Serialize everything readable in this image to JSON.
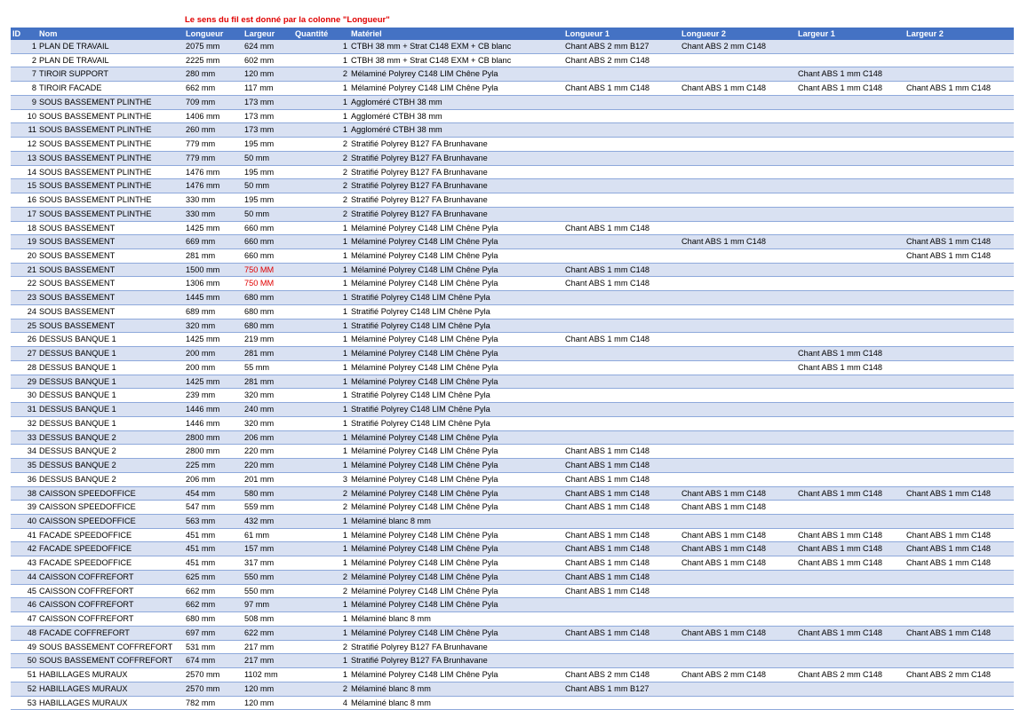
{
  "note": "Le sens du fil est donné par la colonne \"Longueur\"",
  "headers": [
    "ID",
    "Nom",
    "Longueur",
    "Largeur",
    "Quantité",
    "Matériel",
    "Longueur 1",
    "Longueur 2",
    "Largeur 1",
    "Largeur 2"
  ],
  "highlight_color": "#e00000",
  "header_color": "#4472c4",
  "band_color": "#d9e1f2",
  "rows": [
    {
      "id": "1",
      "nom": "PLAN DE TRAVAIL",
      "longueur": "2075 mm",
      "largeur": "624 mm",
      "quantite": "1",
      "materiel": "CTBH 38 mm + Strat C148 EXM + CB blanc",
      "l1": "Chant ABS 2 mm B127",
      "l2": "Chant ABS 2 mm C148",
      "w1": "",
      "w2": ""
    },
    {
      "id": "2",
      "nom": "PLAN DE TRAVAIL",
      "longueur": "2225 mm",
      "largeur": "602 mm",
      "quantite": "1",
      "materiel": "CTBH 38 mm + Strat C148 EXM + CB blanc",
      "l1": "Chant ABS 2 mm C148",
      "l2": "",
      "w1": "",
      "w2": ""
    },
    {
      "id": "7",
      "nom": "TIROIR SUPPORT",
      "longueur": "280 mm",
      "largeur": "120 mm",
      "quantite": "2",
      "materiel": "Mélaminé Polyrey C148 LIM Chêne Pyla",
      "l1": "",
      "l2": "",
      "w1": "Chant ABS 1 mm C148",
      "w2": ""
    },
    {
      "id": "8",
      "nom": "TIROIR FACADE",
      "longueur": "662 mm",
      "largeur": "117 mm",
      "quantite": "1",
      "materiel": "Mélaminé Polyrey C148 LIM Chêne Pyla",
      "l1": "Chant ABS 1 mm C148",
      "l2": "Chant ABS 1 mm C148",
      "w1": "Chant ABS 1 mm C148",
      "w2": "Chant ABS 1 mm C148"
    },
    {
      "id": "9",
      "nom": "SOUS BASSEMENT PLINTHE",
      "longueur": "709 mm",
      "largeur": "173 mm",
      "quantite": "1",
      "materiel": "Aggloméré CTBH 38 mm",
      "l1": "",
      "l2": "",
      "w1": "",
      "w2": ""
    },
    {
      "id": "10",
      "nom": "SOUS BASSEMENT PLINTHE",
      "longueur": "1406 mm",
      "largeur": "173 mm",
      "quantite": "1",
      "materiel": "Aggloméré CTBH 38 mm",
      "l1": "",
      "l2": "",
      "w1": "",
      "w2": ""
    },
    {
      "id": "11",
      "nom": "SOUS BASSEMENT PLINTHE",
      "longueur": "260 mm",
      "largeur": "173 mm",
      "quantite": "1",
      "materiel": "Aggloméré CTBH 38 mm",
      "l1": "",
      "l2": "",
      "w1": "",
      "w2": ""
    },
    {
      "id": "12",
      "nom": "SOUS BASSEMENT PLINTHE",
      "longueur": "779 mm",
      "largeur": "195 mm",
      "quantite": "2",
      "materiel": "Stratifié Polyrey B127 FA Brunhavane",
      "l1": "",
      "l2": "",
      "w1": "",
      "w2": ""
    },
    {
      "id": "13",
      "nom": "SOUS BASSEMENT PLINTHE",
      "longueur": "779 mm",
      "largeur": "50 mm",
      "quantite": "2",
      "materiel": "Stratifié Polyrey B127 FA Brunhavane",
      "l1": "",
      "l2": "",
      "w1": "",
      "w2": ""
    },
    {
      "id": "14",
      "nom": "SOUS BASSEMENT PLINTHE",
      "longueur": "1476 mm",
      "largeur": "195 mm",
      "quantite": "2",
      "materiel": "Stratifié Polyrey B127 FA Brunhavane",
      "l1": "",
      "l2": "",
      "w1": "",
      "w2": ""
    },
    {
      "id": "15",
      "nom": "SOUS BASSEMENT PLINTHE",
      "longueur": "1476 mm",
      "largeur": "50 mm",
      "quantite": "2",
      "materiel": "Stratifié Polyrey B127 FA Brunhavane",
      "l1": "",
      "l2": "",
      "w1": "",
      "w2": ""
    },
    {
      "id": "16",
      "nom": "SOUS BASSEMENT PLINTHE",
      "longueur": "330 mm",
      "largeur": "195 mm",
      "quantite": "2",
      "materiel": "Stratifié Polyrey B127 FA Brunhavane",
      "l1": "",
      "l2": "",
      "w1": "",
      "w2": ""
    },
    {
      "id": "17",
      "nom": "SOUS BASSEMENT PLINTHE",
      "longueur": "330 mm",
      "largeur": "50 mm",
      "quantite": "2",
      "materiel": "Stratifié Polyrey B127 FA Brunhavane",
      "l1": "",
      "l2": "",
      "w1": "",
      "w2": ""
    },
    {
      "id": "18",
      "nom": "SOUS BASSEMENT",
      "longueur": "1425 mm",
      "largeur": "660 mm",
      "quantite": "1",
      "materiel": "Mélaminé Polyrey C148 LIM Chêne Pyla",
      "l1": "Chant ABS 1 mm C148",
      "l2": "",
      "w1": "",
      "w2": ""
    },
    {
      "id": "19",
      "nom": "SOUS BASSEMENT",
      "longueur": "669 mm",
      "largeur": "660 mm",
      "quantite": "1",
      "materiel": "Mélaminé Polyrey C148 LIM Chêne Pyla",
      "l1": "",
      "l2": "Chant ABS 1 mm C148",
      "w1": "",
      "w2": "Chant ABS 1 mm C148"
    },
    {
      "id": "20",
      "nom": "SOUS BASSEMENT",
      "longueur": "281 mm",
      "largeur": "660 mm",
      "quantite": "1",
      "materiel": "Mélaminé Polyrey C148 LIM Chêne Pyla",
      "l1": "",
      "l2": "",
      "w1": "",
      "w2": "Chant ABS 1 mm C148"
    },
    {
      "id": "21",
      "nom": "SOUS BASSEMENT",
      "longueur": "1500 mm",
      "largeur": "750 MM",
      "quantite": "1",
      "materiel": "Mélaminé Polyrey C148 LIM Chêne Pyla",
      "l1": "Chant ABS 1 mm C148",
      "l2": "",
      "w1": "",
      "w2": "",
      "red": true
    },
    {
      "id": "22",
      "nom": "SOUS BASSEMENT",
      "longueur": "1306 mm",
      "largeur": "750 MM",
      "quantite": "1",
      "materiel": "Mélaminé Polyrey C148 LIM Chêne Pyla",
      "l1": "Chant ABS 1 mm C148",
      "l2": "",
      "w1": "",
      "w2": "",
      "red": true
    },
    {
      "id": "23",
      "nom": "SOUS BASSEMENT",
      "longueur": "1445 mm",
      "largeur": "680 mm",
      "quantite": "1",
      "materiel": "Stratifié Polyrey C148 LIM Chêne Pyla",
      "l1": "",
      "l2": "",
      "w1": "",
      "w2": ""
    },
    {
      "id": "24",
      "nom": "SOUS BASSEMENT",
      "longueur": "689 mm",
      "largeur": "680 mm",
      "quantite": "1",
      "materiel": "Stratifié Polyrey C148 LIM Chêne Pyla",
      "l1": "",
      "l2": "",
      "w1": "",
      "w2": ""
    },
    {
      "id": "25",
      "nom": "SOUS BASSEMENT",
      "longueur": "320 mm",
      "largeur": "680 mm",
      "quantite": "1",
      "materiel": "Stratifié Polyrey C148 LIM Chêne Pyla",
      "l1": "",
      "l2": "",
      "w1": "",
      "w2": ""
    },
    {
      "id": "26",
      "nom": "DESSUS BANQUE 1",
      "longueur": "1425 mm",
      "largeur": "219 mm",
      "quantite": "1",
      "materiel": "Mélaminé Polyrey C148 LIM Chêne Pyla",
      "l1": "Chant ABS 1 mm C148",
      "l2": "",
      "w1": "",
      "w2": ""
    },
    {
      "id": "27",
      "nom": "DESSUS BANQUE 1",
      "longueur": "200 mm",
      "largeur": "281 mm",
      "quantite": "1",
      "materiel": "Mélaminé Polyrey C148 LIM Chêne Pyla",
      "l1": "",
      "l2": "",
      "w1": "Chant ABS 1 mm C148",
      "w2": ""
    },
    {
      "id": "28",
      "nom": "DESSUS BANQUE 1",
      "longueur": "200 mm",
      "largeur": "55 mm",
      "quantite": "1",
      "materiel": "Mélaminé Polyrey C148 LIM Chêne Pyla",
      "l1": "",
      "l2": "",
      "w1": "Chant ABS 1 mm C148",
      "w2": ""
    },
    {
      "id": "29",
      "nom": "DESSUS BANQUE 1",
      "longueur": "1425 mm",
      "largeur": "281 mm",
      "quantite": "1",
      "materiel": "Mélaminé Polyrey C148 LIM Chêne Pyla",
      "l1": "",
      "l2": "",
      "w1": "",
      "w2": ""
    },
    {
      "id": "30",
      "nom": "DESSUS BANQUE 1",
      "longueur": "239 mm",
      "largeur": "320 mm",
      "quantite": "1",
      "materiel": "Stratifié Polyrey C148 LIM Chêne Pyla",
      "l1": "",
      "l2": "",
      "w1": "",
      "w2": ""
    },
    {
      "id": "31",
      "nom": "DESSUS BANQUE 1",
      "longueur": "1446 mm",
      "largeur": "240 mm",
      "quantite": "1",
      "materiel": "Stratifié Polyrey C148 LIM Chêne Pyla",
      "l1": "",
      "l2": "",
      "w1": "",
      "w2": ""
    },
    {
      "id": "32",
      "nom": "DESSUS BANQUE 1",
      "longueur": "1446 mm",
      "largeur": "320 mm",
      "quantite": "1",
      "materiel": "Stratifié Polyrey C148 LIM Chêne Pyla",
      "l1": "",
      "l2": "",
      "w1": "",
      "w2": ""
    },
    {
      "id": "33",
      "nom": "DESSUS BANQUE 2",
      "longueur": "2800 mm",
      "largeur": "206 mm",
      "quantite": "1",
      "materiel": "Mélaminé Polyrey C148 LIM Chêne Pyla",
      "l1": "",
      "l2": "",
      "w1": "",
      "w2": ""
    },
    {
      "id": "34",
      "nom": "DESSUS BANQUE 2",
      "longueur": "2800 mm",
      "largeur": "220 mm",
      "quantite": "1",
      "materiel": "Mélaminé Polyrey C148 LIM Chêne Pyla",
      "l1": "Chant ABS 1 mm C148",
      "l2": "",
      "w1": "",
      "w2": ""
    },
    {
      "id": "35",
      "nom": "DESSUS BANQUE 2",
      "longueur": "225 mm",
      "largeur": "220 mm",
      "quantite": "1",
      "materiel": "Mélaminé Polyrey C148 LIM Chêne Pyla",
      "l1": "Chant ABS 1 mm C148",
      "l2": "",
      "w1": "",
      "w2": ""
    },
    {
      "id": "36",
      "nom": "DESSUS BANQUE 2",
      "longueur": "206 mm",
      "largeur": "201 mm",
      "quantite": "3",
      "materiel": "Mélaminé Polyrey C148 LIM Chêne Pyla",
      "l1": "Chant ABS 1 mm C148",
      "l2": "",
      "w1": "",
      "w2": ""
    },
    {
      "id": "38",
      "nom": "CAISSON SPEEDOFFICE",
      "longueur": "454 mm",
      "largeur": "580 mm",
      "quantite": "2",
      "materiel": "Mélaminé Polyrey C148 LIM Chêne Pyla",
      "l1": "Chant ABS 1 mm C148",
      "l2": "Chant ABS 1 mm C148",
      "w1": "Chant ABS 1 mm C148",
      "w2": "Chant ABS 1 mm C148"
    },
    {
      "id": "39",
      "nom": "CAISSON SPEEDOFFICE",
      "longueur": "547 mm",
      "largeur": "559 mm",
      "quantite": "2",
      "materiel": "Mélaminé Polyrey C148 LIM Chêne Pyla",
      "l1": "Chant ABS 1 mm C148",
      "l2": "Chant ABS 1 mm C148",
      "w1": "",
      "w2": ""
    },
    {
      "id": "40",
      "nom": "CAISSON SPEEDOFFICE",
      "longueur": "563 mm",
      "largeur": "432 mm",
      "quantite": "1",
      "materiel": "Mélaminé blanc 8 mm",
      "l1": "",
      "l2": "",
      "w1": "",
      "w2": ""
    },
    {
      "id": "41",
      "nom": "FACADE SPEEDOFFICE",
      "longueur": "451 mm",
      "largeur": "61 mm",
      "quantite": "1",
      "materiel": "Mélaminé Polyrey C148 LIM Chêne Pyla",
      "l1": "Chant ABS 1 mm C148",
      "l2": "Chant ABS 1 mm C148",
      "w1": "Chant ABS 1 mm C148",
      "w2": "Chant ABS 1 mm C148"
    },
    {
      "id": "42",
      "nom": "FACADE SPEEDOFFICE",
      "longueur": "451 mm",
      "largeur": "157 mm",
      "quantite": "1",
      "materiel": "Mélaminé Polyrey C148 LIM Chêne Pyla",
      "l1": "Chant ABS 1 mm C148",
      "l2": "Chant ABS 1 mm C148",
      "w1": "Chant ABS 1 mm C148",
      "w2": "Chant ABS 1 mm C148"
    },
    {
      "id": "43",
      "nom": "FACADE SPEEDOFFICE",
      "longueur": "451 mm",
      "largeur": "317 mm",
      "quantite": "1",
      "materiel": "Mélaminé Polyrey C148 LIM Chêne Pyla",
      "l1": "Chant ABS 1 mm C148",
      "l2": "Chant ABS 1 mm C148",
      "w1": "Chant ABS 1 mm C148",
      "w2": "Chant ABS 1 mm C148"
    },
    {
      "id": "44",
      "nom": "CAISSON COFFREFORT",
      "longueur": "625 mm",
      "largeur": "550 mm",
      "quantite": "2",
      "materiel": "Mélaminé Polyrey C148 LIM Chêne Pyla",
      "l1": "Chant ABS 1 mm C148",
      "l2": "",
      "w1": "",
      "w2": ""
    },
    {
      "id": "45",
      "nom": "CAISSON COFFREFORT",
      "longueur": "662 mm",
      "largeur": "550 mm",
      "quantite": "2",
      "materiel": "Mélaminé Polyrey C148 LIM Chêne Pyla",
      "l1": "Chant ABS 1 mm C148",
      "l2": "",
      "w1": "",
      "w2": ""
    },
    {
      "id": "46",
      "nom": "CAISSON COFFREFORT",
      "longueur": "662 mm",
      "largeur": "97 mm",
      "quantite": "1",
      "materiel": "Mélaminé Polyrey C148 LIM Chêne Pyla",
      "l1": "",
      "l2": "",
      "w1": "",
      "w2": ""
    },
    {
      "id": "47",
      "nom": "CAISSON COFFREFORT",
      "longueur": "680 mm",
      "largeur": "508 mm",
      "quantite": "1",
      "materiel": "Mélaminé blanc 8 mm",
      "l1": "",
      "l2": "",
      "w1": "",
      "w2": ""
    },
    {
      "id": "48",
      "nom": "FACADE COFFREFORT",
      "longueur": "697 mm",
      "largeur": "622 mm",
      "quantite": "1",
      "materiel": "Mélaminé Polyrey C148 LIM Chêne Pyla",
      "l1": "Chant ABS 1 mm C148",
      "l2": "Chant ABS 1 mm C148",
      "w1": "Chant ABS 1 mm C148",
      "w2": "Chant ABS 1 mm C148"
    },
    {
      "id": "49",
      "nom": "SOUS BASSEMENT COFFREFORT",
      "longueur": "531 mm",
      "largeur": "217 mm",
      "quantite": "2",
      "materiel": "Stratifié Polyrey B127 FA Brunhavane",
      "l1": "",
      "l2": "",
      "w1": "",
      "w2": ""
    },
    {
      "id": "50",
      "nom": "SOUS BASSEMENT COFFREFORT",
      "longueur": "674 mm",
      "largeur": "217 mm",
      "quantite": "1",
      "materiel": "Stratifié Polyrey B127 FA Brunhavane",
      "l1": "",
      "l2": "",
      "w1": "",
      "w2": ""
    },
    {
      "id": "51",
      "nom": "HABILLAGES MURAUX",
      "longueur": "2570 mm",
      "largeur": "1102 mm",
      "quantite": "1",
      "materiel": "Mélaminé Polyrey C148 LIM Chêne Pyla",
      "l1": "Chant ABS 2 mm C148",
      "l2": "Chant ABS 2 mm C148",
      "w1": "Chant ABS 2 mm C148",
      "w2": "Chant ABS 2 mm C148"
    },
    {
      "id": "52",
      "nom": "HABILLAGES MURAUX",
      "longueur": "2570 mm",
      "largeur": "120 mm",
      "quantite": "2",
      "materiel": "Mélaminé blanc 8 mm",
      "l1": "Chant ABS 1 mm B127",
      "l2": "",
      "w1": "",
      "w2": ""
    },
    {
      "id": "53",
      "nom": "HABILLAGES MURAUX",
      "longueur": "782 mm",
      "largeur": "120 mm",
      "quantite": "4",
      "materiel": "Mélaminé blanc 8 mm",
      "l1": "",
      "l2": "",
      "w1": "",
      "w2": ""
    }
  ]
}
